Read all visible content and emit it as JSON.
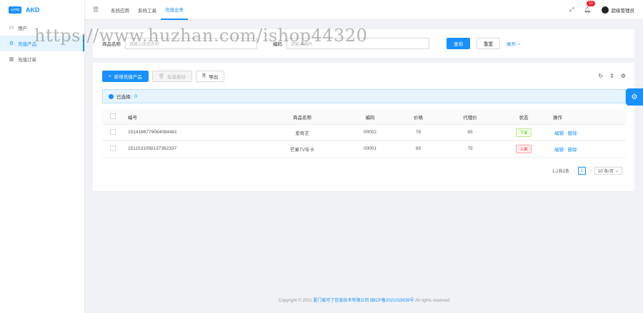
{
  "app": {
    "logo_mark": "云中城",
    "logo_text": "AKD"
  },
  "sidebar": {
    "items": [
      {
        "label": "用户",
        "icon": "user-icon"
      },
      {
        "label": "充值产品",
        "icon": "gear-icon",
        "active": true
      },
      {
        "label": "充值订单",
        "icon": "bar-chart-icon"
      }
    ]
  },
  "header": {
    "tabs": [
      {
        "label": "系统应用"
      },
      {
        "label": "系统工具"
      },
      {
        "label": "充值业务",
        "active": true
      }
    ],
    "notification_count": "12",
    "user_name": "超级管理员"
  },
  "search": {
    "field1_label": "商品名称",
    "field1_placeholder": "请输入商品名称",
    "field2_label": "编码",
    "field2_placeholder": "请输入编码",
    "query_label": "查询",
    "reset_label": "重置",
    "expand_label": "展开"
  },
  "toolbar": {
    "add_label": "新增充值产品",
    "batch_delete_label": "批量删除",
    "export_label": "导出"
  },
  "selection": {
    "prefix": "已选择:",
    "count": "0"
  },
  "table": {
    "columns": [
      "编号",
      "商品名称",
      "编码",
      "价格",
      "代理价",
      "状态",
      "操作"
    ],
    "rows": [
      {
        "id": "1514166779064084481",
        "name": "爱奇艺",
        "code": "00002",
        "price": "78",
        "agent_price": "65",
        "status": "下架",
        "status_color": "#52c41a",
        "edit": "编辑",
        "delete": "删除"
      },
      {
        "id": "1511531058137362337",
        "name": "芒果TV年卡",
        "code": "00001",
        "price": "65",
        "agent_price": "75",
        "status": "上架",
        "status_color": "#f5222d",
        "edit": "编辑",
        "delete": "删除"
      }
    ]
  },
  "pagination": {
    "summary": "1-2共2条",
    "current_page": "1",
    "page_size": "10 条/页"
  },
  "footer": {
    "prefix": "Copyright © 2021",
    "company": "厦门爱可了信息技术有限公司 闽ICP备2021019639号",
    "suffix": "All rights reserved"
  },
  "watermark": "https://www.huzhan.com/ishop44320",
  "colors": {
    "accent": "#1890ff",
    "danger": "#f5222d",
    "success": "#52c41a"
  }
}
